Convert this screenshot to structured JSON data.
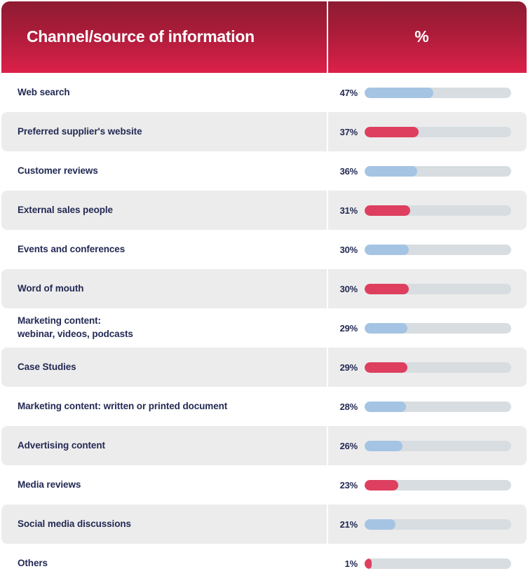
{
  "header": {
    "column_label": "Channel/source of information",
    "column_pct": "%",
    "gradient_top": "#8d1c33",
    "gradient_bottom": "#dc2149",
    "text_color": "#ffffff"
  },
  "colors": {
    "bar_blue": "#a5c4e4",
    "bar_red": "#de3f5f",
    "bar_track": "#d7dde0",
    "row_alt_bg": "#ececec",
    "row_bg": "#ffffff",
    "label_text": "#232a54"
  },
  "chart_data": {
    "type": "bar",
    "title": "Channel/source of information",
    "xlabel": "%",
    "ylabel": "Channel/source of information",
    "xlim": [
      0,
      100
    ],
    "grid": false,
    "legend": "none",
    "orientation": "horizontal",
    "categories": [
      "Web search",
      "Preferred supplier's website",
      "Customer reviews",
      "External sales people",
      "Events and conferences",
      "Word of mouth",
      "Marketing content:\nwebinar, videos, podcasts",
      "Case Studies",
      "Marketing content: written or printed document",
      "Advertising content",
      "Media reviews",
      "Social media discussions",
      "Others"
    ],
    "values": [
      47,
      37,
      36,
      31,
      30,
      30,
      29,
      29,
      28,
      26,
      23,
      21,
      1
    ]
  },
  "rows": [
    {
      "label": "Web search",
      "label_line2": "",
      "pct": "47%",
      "value": 47,
      "color": "blue",
      "alt": false
    },
    {
      "label": "Preferred supplier's website",
      "label_line2": "",
      "pct": "37%",
      "value": 37,
      "color": "red",
      "alt": true
    },
    {
      "label": "Customer reviews",
      "label_line2": "",
      "pct": "36%",
      "value": 36,
      "color": "blue",
      "alt": false
    },
    {
      "label": "External sales people",
      "label_line2": "",
      "pct": "31%",
      "value": 31,
      "color": "red",
      "alt": true
    },
    {
      "label": "Events and conferences",
      "label_line2": "",
      "pct": "30%",
      "value": 30,
      "color": "blue",
      "alt": false
    },
    {
      "label": "Word of mouth",
      "label_line2": "",
      "pct": "30%",
      "value": 30,
      "color": "red",
      "alt": true
    },
    {
      "label": "Marketing content:",
      "label_line2": "webinar, videos, podcasts",
      "pct": "29%",
      "value": 29,
      "color": "blue",
      "alt": false
    },
    {
      "label": "Case Studies",
      "label_line2": "",
      "pct": "29%",
      "value": 29,
      "color": "red",
      "alt": true
    },
    {
      "label": "Marketing content: written or printed document",
      "label_line2": "",
      "pct": "28%",
      "value": 28,
      "color": "blue",
      "alt": false
    },
    {
      "label": "Advertising content",
      "label_line2": "",
      "pct": "26%",
      "value": 26,
      "color": "blue",
      "alt": true
    },
    {
      "label": "Media reviews",
      "label_line2": "",
      "pct": "23%",
      "value": 23,
      "color": "red",
      "alt": false
    },
    {
      "label": "Social media discussions",
      "label_line2": "",
      "pct": "21%",
      "value": 21,
      "color": "blue",
      "alt": true
    },
    {
      "label": "Others",
      "label_line2": "",
      "pct": "1%",
      "value": 1,
      "color": "red",
      "alt": false
    }
  ]
}
